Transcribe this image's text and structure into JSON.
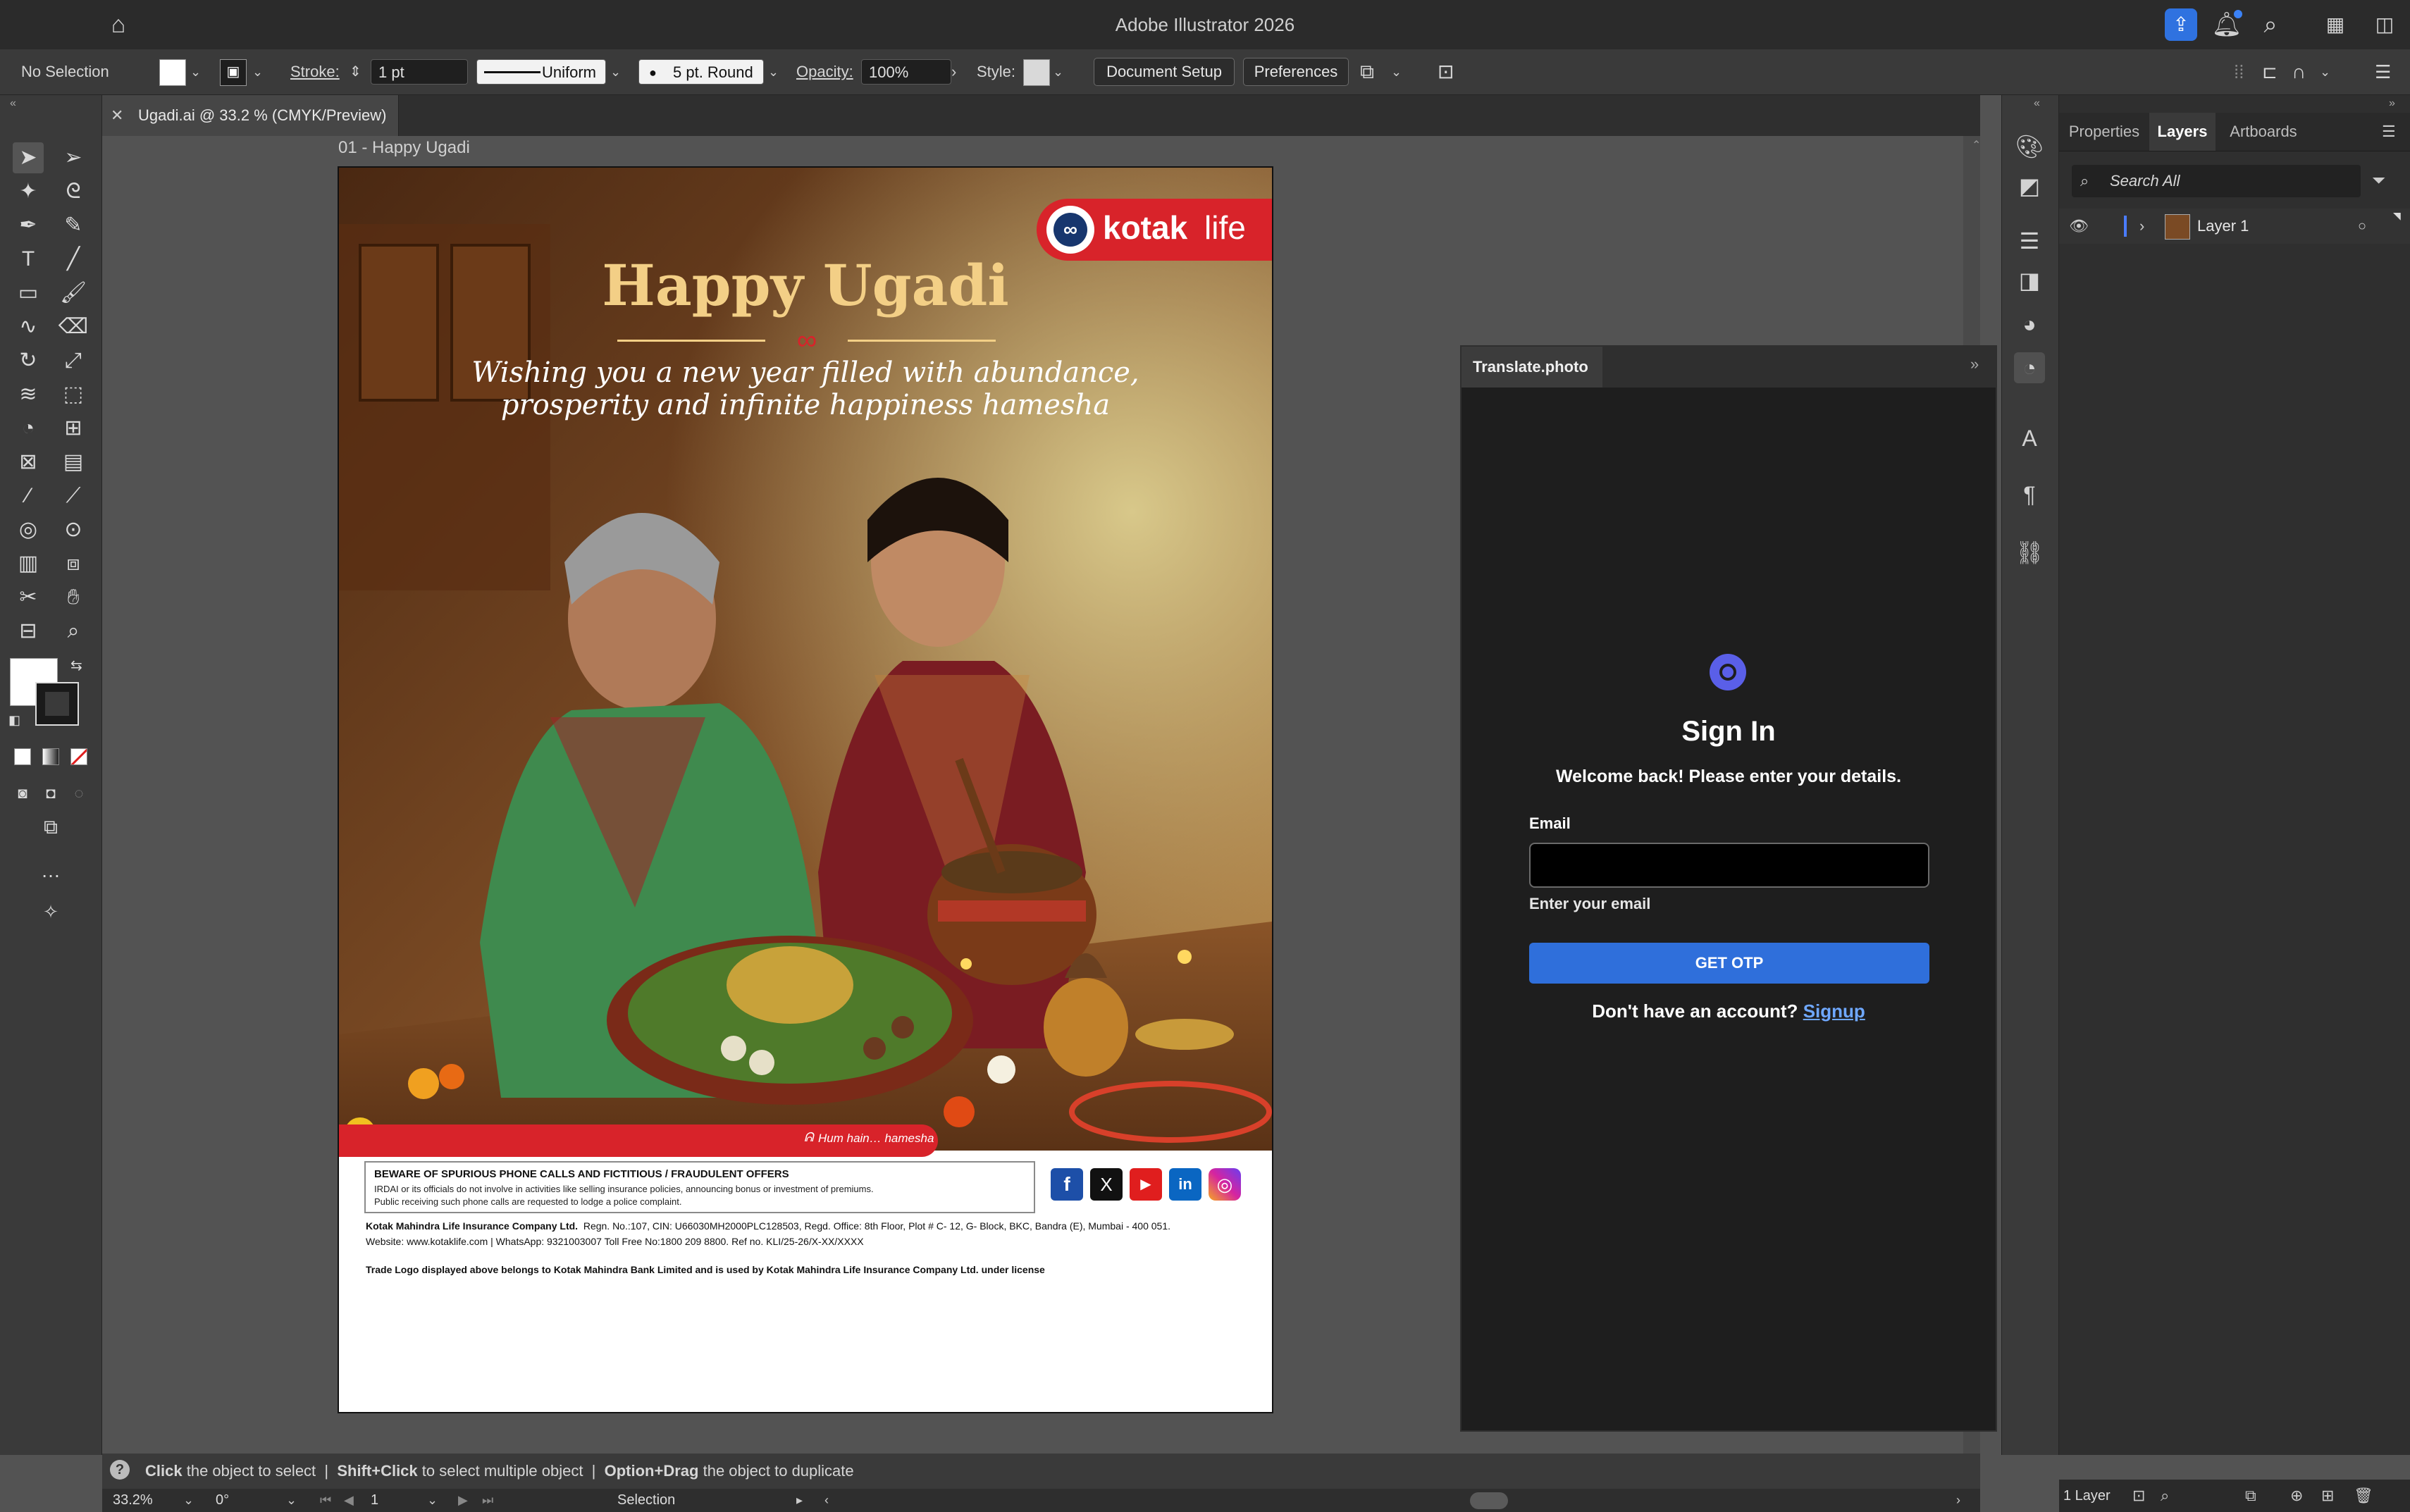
{
  "app": {
    "title": "Adobe Illustrator 2026"
  },
  "control_bar": {
    "selection": "No Selection",
    "stroke_label": "Stroke:",
    "stroke_value": "1 pt",
    "profile": "Uniform",
    "brush": "5 pt. Round",
    "opacity_label": "Opacity:",
    "opacity_value": "100%",
    "style_label": "Style:",
    "document_setup": "Document Setup",
    "preferences": "Preferences"
  },
  "document": {
    "tab_label": "Ugadi.ai @ 33.2 % (CMYK/Preview)",
    "artboard_name": "01 - Happy Ugadi"
  },
  "poster": {
    "brand": "kotak",
    "brand_suffix": "life",
    "headline": "Happy Ugadi",
    "subline_1": "Wishing you a new year filled with abundance,",
    "subline_2": "prosperity and infinite happiness hamesha",
    "tagline": "Hum hain… hamesha",
    "warning_title": "BEWARE OF SPURIOUS PHONE CALLS AND FICTITIOUS / FRAUDULENT OFFERS",
    "warning_line_1": "IRDAI or its officials do not involve in activities like selling insurance policies, announcing bonus or investment of premiums.",
    "warning_line_2": "Public receiving such phone calls are requested to lodge a police complaint.",
    "company": "Kotak Mahindra Life Insurance Company Ltd.",
    "company_details": "Regn. No.:107, CIN: U66030MH2000PLC128503, Regd. Office: 8th Floor, Plot # C- 12, G- Block, BKC, Bandra (E), Mumbai - 400 051.",
    "contact": "Website: www.kotaklife.com | WhatsApp: 9321003007 Toll Free No:1800 209 8800. Ref no. KLI/25-26/X-XX/XXXX",
    "trademark": "Trade Logo displayed above belongs to Kotak Mahindra Bank Limited and is used by Kotak Mahindra Life Insurance Company Ltd. under license",
    "social": [
      "f",
      "𝕏",
      "▶",
      "in",
      "◎"
    ],
    "colors": {
      "brand_red": "#d8232a",
      "headline_gold": "#f3cf86"
    }
  },
  "translate_panel": {
    "title": "Translate.photo",
    "heading": "Sign In",
    "subheading": "Welcome back! Please enter your details.",
    "email_label": "Email",
    "email_hint": "Enter your email",
    "otp_button": "GET OTP",
    "no_account": "Don't have an account?",
    "signup_link": "Signup",
    "accent": "#2f6fdb"
  },
  "layers_panel": {
    "tabs": [
      "Properties",
      "Layers",
      "Artboards"
    ],
    "active_tab": "Layers",
    "search_placeholder": "Search All",
    "layer_name": "Layer 1",
    "layer_count": "1 Layer"
  },
  "status": {
    "hint_click": "Click",
    "hint_1": "the object to select",
    "hint_shift": "Shift+Click",
    "hint_2": "to select multiple object",
    "hint_opt": "Option+Drag",
    "hint_3": "the object to duplicate",
    "zoom": "33.2%",
    "rotation": "0°",
    "artboard_index": "1",
    "tool_readout": "Selection"
  }
}
